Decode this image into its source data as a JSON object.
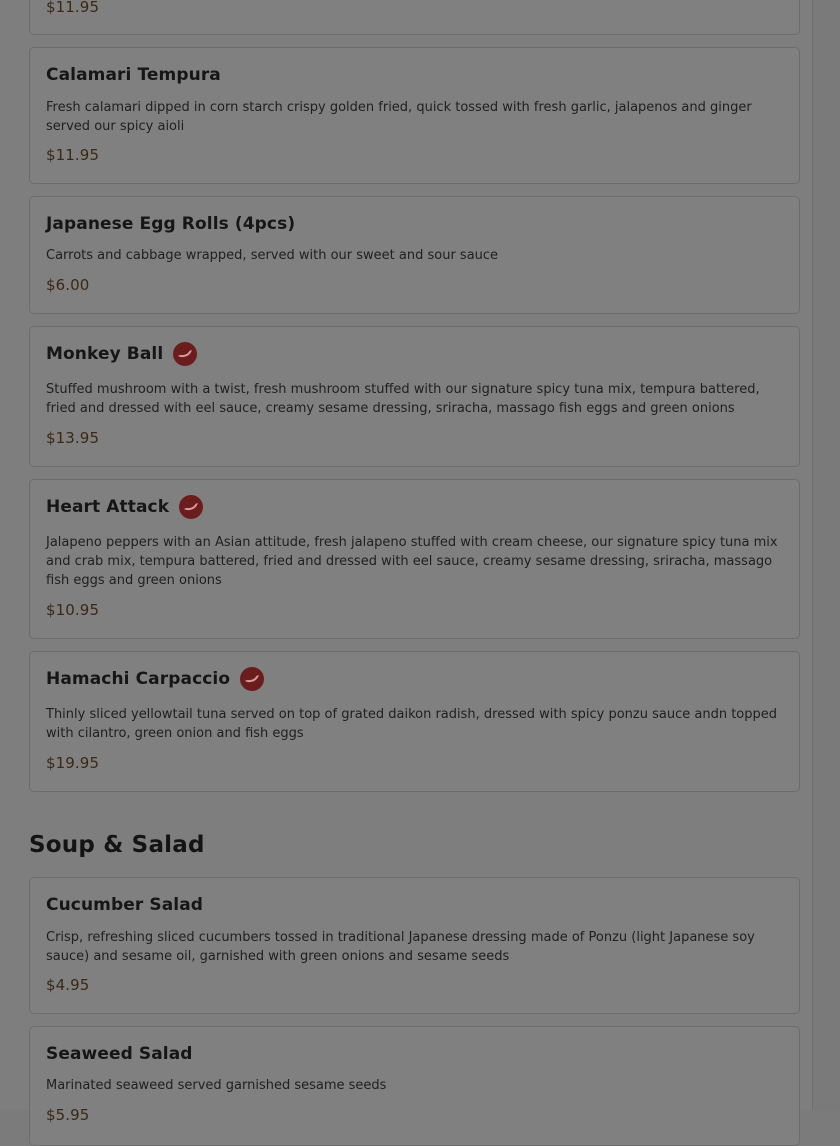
{
  "items": [
    {
      "price": "$11.95"
    },
    {
      "name": "Calamari Tempura",
      "description": "Fresh calamari dipped in corn starch crispy golden fried, quick tossed with fresh garlic, jalapenos and ginger served our spicy aioli",
      "price": "$11.95"
    },
    {
      "name": "Japanese Egg Rolls (4pcs)",
      "description": "Carrots and cabbage wrapped, served with our sweet and sour sauce",
      "price": "$6.00"
    },
    {
      "name": "Monkey Ball",
      "description": "Stuffed mushroom with a twist, fresh mushroom stuffed with our signature spicy tuna mix, tempura battered, fried and dressed with eel sauce, creamy sesame dressing, sriracha, massago fish eggs and green onions",
      "price": "$13.95"
    },
    {
      "name": "Heart Attack",
      "description": "Jalapeno peppers with an Asian attitude, fresh jalapeno stuffed with cream cheese, our signature spicy tuna mix and crab mix, tempura battered, fried and dressed with eel sauce, creamy sesame dressing, sriracha, massago fish eggs and green onions",
      "price": "$10.95"
    },
    {
      "name": "Hamachi Carpaccio",
      "description": "Thinly sliced yellowtail tuna served on top of grated daikon radish, dressed with spicy ponzu sauce andn topped with cilantro, green onion and fish eggs",
      "price": "$19.95"
    },
    {
      "name": "Cucumber Salad",
      "description": "Crisp, refreshing sliced cucumbers tossed in traditional Japanese dressing made of Ponzu (light Japanese soy sauce) and sesame oil, garnished with green onions and sesame seeds",
      "price": "$4.95"
    },
    {
      "name": "Seaweed Salad",
      "description": "Marinated seaweed served garnished sesame seeds",
      "price": "$5.95"
    }
  ],
  "sections": {
    "soup_salad": "Soup & Salad"
  },
  "icons": {
    "spicy": "spicy-pepper-icon"
  },
  "colors": {
    "overlay": "#7e7e7e",
    "card_border": "#6c6c6c",
    "title_text": "#161616",
    "price_text": "#3b2715",
    "spicy_icon_bg": "#6b1d1d"
  }
}
